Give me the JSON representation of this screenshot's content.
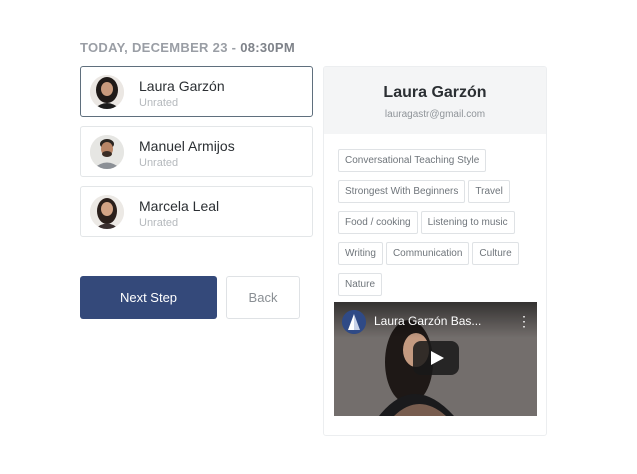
{
  "session": {
    "date_label": "TODAY, DECEMBER 23",
    "separator": " - ",
    "time_label": "08:30PM"
  },
  "tutors": [
    {
      "name": "Laura Garzón",
      "status": "Unrated",
      "selected": true
    },
    {
      "name": "Manuel Armijos",
      "status": "Unrated",
      "selected": false
    },
    {
      "name": "Marcela Leal",
      "status": "Unrated",
      "selected": false
    }
  ],
  "actions": {
    "next_label": "Next Step",
    "back_label": "Back"
  },
  "profile": {
    "name": "Laura Garzón",
    "email": "lauragastr@gmail.com",
    "tags": [
      "Conversational Teaching Style",
      "Strongest With Beginners",
      "Travel",
      "Food / cooking",
      "Listening to music",
      "Writing",
      "Communication",
      "Culture",
      "Nature"
    ],
    "video": {
      "title": "Laura Garzón Bas...",
      "channel_icon": "channel-logo-icon",
      "play_icon": "play-icon",
      "menu_icon": "more-vertical-icon"
    }
  },
  "colors": {
    "primary": "#34497a",
    "selected_border": "#5f6f7d",
    "header_bg": "#f4f5f6"
  }
}
